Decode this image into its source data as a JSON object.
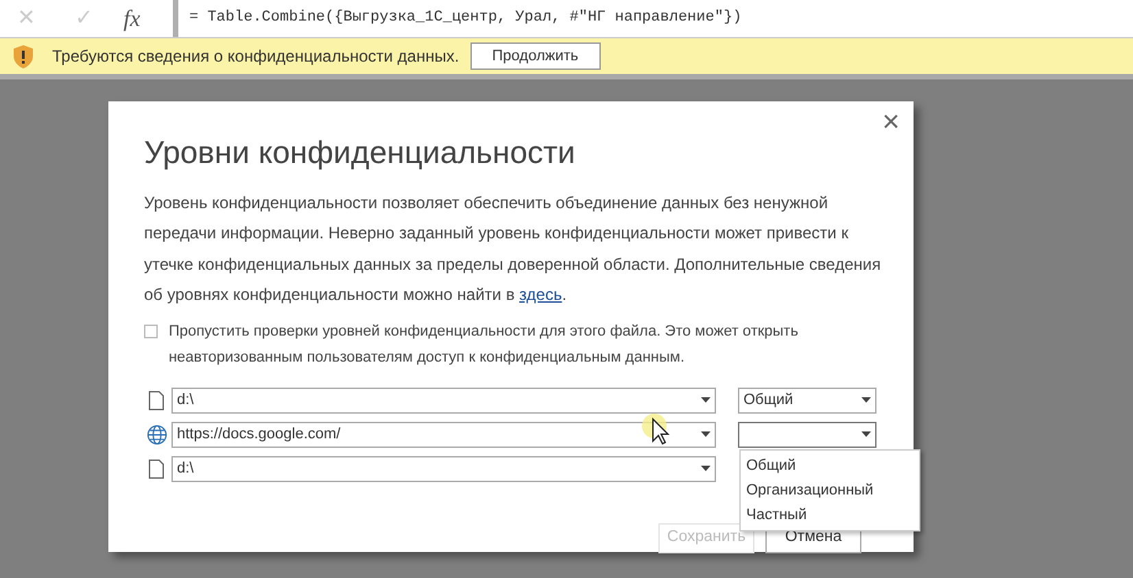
{
  "formula_bar": {
    "cancel": "✕",
    "confirm": "✓",
    "fx": "fx",
    "formula": "= Table.Combine({Выгрузка_1С_центр, Урал, #\"НГ направление\"})"
  },
  "warning_bar": {
    "message": "Требуются сведения о конфиденциальности данных.",
    "button": "Продолжить"
  },
  "dialog": {
    "title": "Уровни конфиденциальности",
    "close": "×",
    "description": "Уровень конфиденциальности позволяет обеспечить объединение данных без ненужной передачи информации. Неверно заданный уровень конфиденциальности может привести к утечке конфиденциальных данных за пределы доверенной области. Дополнительные сведения об уровнях конфиденциальности можно найти в ",
    "link": "здесь",
    "description_end": ".",
    "skip_checkbox": {
      "label": "Пропустить проверки уровней конфиденциальности для этого файла. Это может открыть неавторизованным пользователям доступ к конфиденциальным данным.",
      "checked": false
    },
    "sources": [
      {
        "kind": "file",
        "source": "d:\\",
        "privacy": {
          "level": "Общий",
          "expanded": false
        }
      },
      {
        "kind": "web",
        "source": "https://docs.google.com/",
        "privacy": {
          "expanded": true,
          "options": [
            "Общий",
            "Организационный",
            "Частный"
          ]
        }
      },
      {
        "kind": "file",
        "source": "d:\\"
      }
    ],
    "buttons": [
      {
        "label": "Сохранить",
        "disabled": true
      },
      {
        "label": "Отмена",
        "disabled": false
      }
    ]
  }
}
